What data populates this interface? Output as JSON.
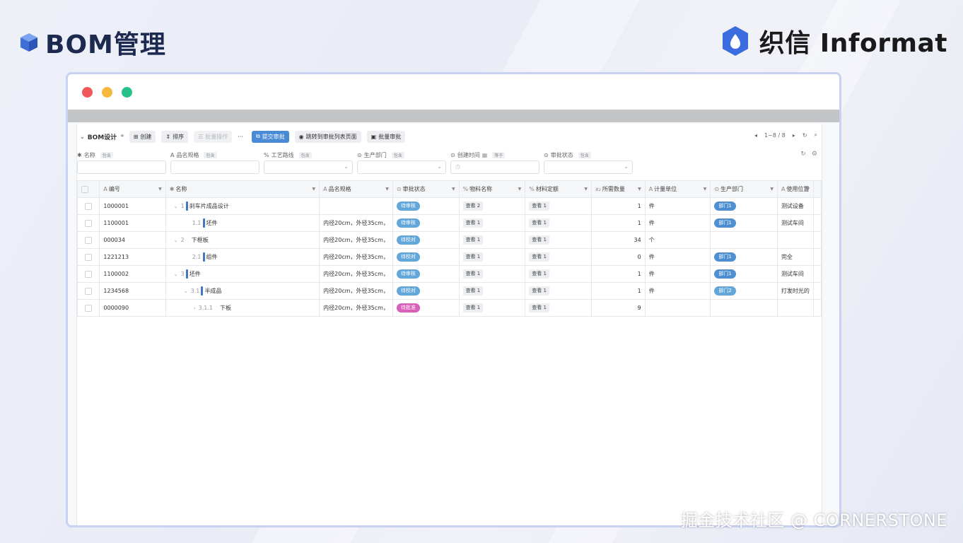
{
  "page": {
    "title": "BOM管理",
    "brand": "织信 Informat",
    "watermark": "掘金技术社区 @ CORNERSTONE"
  },
  "colors": {
    "accent": "#4a8bd6",
    "traffic_red": "#f0585b",
    "traffic_yellow": "#f5b93f",
    "traffic_green": "#26c28a",
    "tag_blue": "#62a6da",
    "tag_pink": "#d95fb8",
    "tag_dept": "#4e8fd2"
  },
  "toolbar": {
    "title": "BOM设计",
    "create": "创建",
    "sort": "排序",
    "batch": "批量操作",
    "more": "···",
    "submit": "提交审批",
    "goto": "跳转到审批列表页面",
    "batch_approve": "批量审批",
    "pagination": "1~8 / 8"
  },
  "filters": [
    {
      "label": "名称",
      "op": "包含",
      "icon": "✱",
      "select": false
    },
    {
      "label": "品名规格",
      "op": "包含",
      "icon": "A",
      "select": false
    },
    {
      "label": "工艺路线",
      "op": "包含",
      "icon": "%",
      "select": true
    },
    {
      "label": "生产部门",
      "op": "包含",
      "icon": "⊙",
      "select": true
    },
    {
      "label": "创建时间",
      "op": "等于",
      "icon": "⊙",
      "select": false,
      "clock": true
    },
    {
      "label": "审批状态",
      "op": "包含",
      "icon": "⊙",
      "select": true
    }
  ],
  "columns": [
    {
      "icon": "A",
      "label": "编号"
    },
    {
      "icon": "✱",
      "label": "名称"
    },
    {
      "icon": "A",
      "label": "品名规格"
    },
    {
      "icon": "⊙",
      "label": "审批状态"
    },
    {
      "icon": "%",
      "label": "物料名称"
    },
    {
      "icon": "%",
      "label": "材料定额"
    },
    {
      "icon": "x₂",
      "label": "所需数量"
    },
    {
      "icon": "A",
      "label": "计量单位"
    },
    {
      "icon": "⊙",
      "label": "生产部门"
    },
    {
      "icon": "A",
      "label": "使用位置"
    }
  ],
  "rows": [
    {
      "code": "1000001",
      "arrow": "⌄",
      "level": "1",
      "indent": 0,
      "bar": true,
      "name": "刹车片成品设计",
      "spec": "",
      "status": "待审核",
      "status_color": "#62a6da",
      "material": "查看 2",
      "quota": "查看 1",
      "qty": "1",
      "unit": "件",
      "dept": "部门1",
      "location": "测试设备"
    },
    {
      "code": "1100001",
      "arrow": "",
      "level": "1.1",
      "indent": 1,
      "bar": true,
      "name": "坯件",
      "spec": "内径20cm，外径35cm，",
      "status": "待审核",
      "status_color": "#62a6da",
      "material": "查看 1",
      "quota": "查看 1",
      "qty": "1",
      "unit": "件",
      "dept": "部门1",
      "location": "测试车间"
    },
    {
      "code": "000034",
      "arrow": "⌄",
      "level": "2",
      "indent": 0,
      "bar": false,
      "name": "下框板",
      "spec": "内径20cm，外径35cm，",
      "status": "待校对",
      "status_color": "#62a6da",
      "material": "查看 1",
      "quota": "查看 1",
      "qty": "34",
      "unit": "个",
      "dept": "",
      "location": ""
    },
    {
      "code": "1221213",
      "arrow": "",
      "level": "2.1",
      "indent": 1,
      "bar": true,
      "name": "组件",
      "spec": "内径20cm，外径35cm，",
      "status": "待校对",
      "status_color": "#62a6da",
      "material": "查看 1",
      "quota": "查看 1",
      "qty": "0",
      "unit": "件",
      "dept": "部门1",
      "location": "完全"
    },
    {
      "code": "1100002",
      "arrow": "⌄",
      "level": "3",
      "indent": 0,
      "bar": true,
      "name": "坯件",
      "spec": "内径20cm，外径35cm，",
      "status": "待审核",
      "status_color": "#62a6da",
      "material": "查看 1",
      "quota": "查看 1",
      "qty": "1",
      "unit": "件",
      "dept": "部门1",
      "location": "测试车间"
    },
    {
      "code": "1234568",
      "arrow": "⌄",
      "level": "3.1",
      "indent": 1,
      "bar": true,
      "name": "半成品",
      "spec": "内径20cm，外径35cm，",
      "status": "待校对",
      "status_color": "#62a6da",
      "material": "查看 1",
      "quota": "查看 1",
      "qty": "1",
      "unit": "件",
      "dept": "部门2",
      "location": "打发时光的"
    },
    {
      "code": "0000090",
      "arrow": "›",
      "level": "3.1.1",
      "indent": 2,
      "bar": false,
      "name": "下板",
      "spec": "内径20cm，外径35cm，",
      "status": "待批准",
      "status_color": "#d95fb8",
      "material": "查看 1",
      "quota": "查看 1",
      "qty": "9",
      "unit": "",
      "dept": "",
      "location": ""
    }
  ]
}
